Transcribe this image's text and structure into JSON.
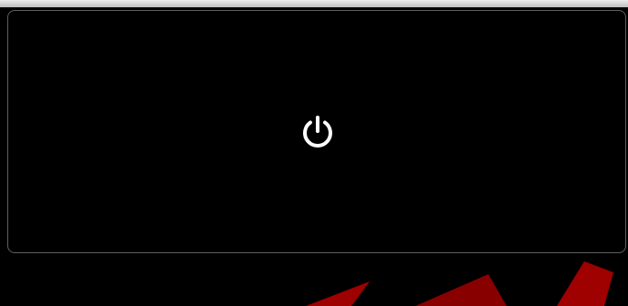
{
  "screen": {
    "state": "off",
    "power_icon": "power-icon"
  },
  "colors": {
    "background": "#000000",
    "panel_border": "#5f5f5f",
    "icon": "#ffffff",
    "top_strip": "#d8d8d8",
    "watermark": "#c00000"
  }
}
